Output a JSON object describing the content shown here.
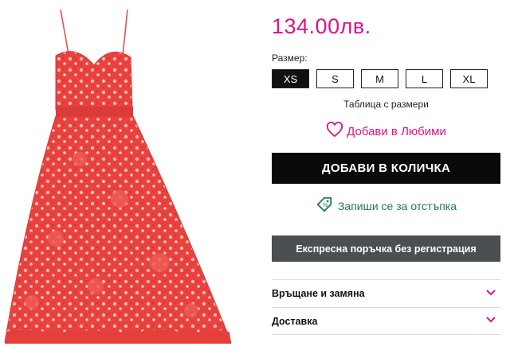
{
  "product": {
    "price": "134.00лв.",
    "size_label": "Размер:",
    "sizes": [
      "XS",
      "S",
      "M",
      "L",
      "XL"
    ],
    "selected_size": "XS",
    "size_chart_link": "Таблица с размери",
    "favorite_label": "Добави в Любими",
    "add_to_cart_label": "ДОБАВИ В КОЛИЧКА",
    "discount_label": "Запиши се за отстъпка",
    "express_order_label": "Експресна поръчка без регистрация"
  },
  "accordion": [
    {
      "label": "Връщане и замяна"
    },
    {
      "label": "Доставка"
    }
  ],
  "colors": {
    "accent": "#e0128b",
    "dress": "#e8413e",
    "button_dark": "#0a0a0a",
    "button_gray": "#4a4f52",
    "discount_green": "#1f7a4e"
  },
  "icons": {
    "favorite": "heart-icon",
    "discount": "tag-icon",
    "accordion": "chevron-down-icon"
  }
}
